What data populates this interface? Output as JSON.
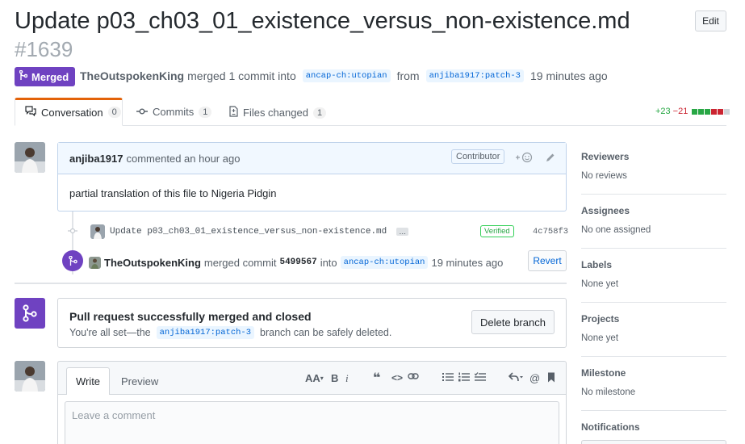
{
  "header": {
    "title": "Update p03_ch03_01_existence_versus_non-existence.md",
    "number": "#1639",
    "edit_label": "Edit"
  },
  "state": {
    "badge_label": "Merged",
    "author": "TheOutspokenKing",
    "merged_text": "merged 1 commit into",
    "base_branch": "ancap-ch:utopian",
    "from_text": "from",
    "head_branch": "anjiba1917:patch-3",
    "time": "19 minutes ago"
  },
  "tabs": [
    {
      "label": "Conversation",
      "count": "0"
    },
    {
      "label": "Commits",
      "count": "1"
    },
    {
      "label": "Files changed",
      "count": "1"
    }
  ],
  "diffstat": {
    "additions": "+23",
    "deletions": "−21",
    "colors": [
      "#28a745",
      "#28a745",
      "#28a745",
      "#cb2431",
      "#cb2431",
      "#d1d5da"
    ]
  },
  "comment": {
    "author": "anjiba1917",
    "action": "commented an hour ago",
    "role": "Contributor",
    "body": "partial translation of this file to Nigeria Pidgin"
  },
  "commit": {
    "message": "Update p03_ch03_01_existence_versus_non-existence.md",
    "ellipsis": "…",
    "verified": "Verified",
    "sha": "4c758f3"
  },
  "merge_event": {
    "author": "TheOutspokenKing",
    "text1": "merged commit",
    "commit_sha": "5499567",
    "text2": "into",
    "branch": "ancap-ch:utopian",
    "time": "19 minutes ago",
    "revert_label": "Revert"
  },
  "merged_box": {
    "title": "Pull request successfully merged and closed",
    "sub1": "You're all set—the",
    "branch": "anjiba1917:patch-3",
    "sub2": "branch can be safely deleted.",
    "delete_label": "Delete branch"
  },
  "composer": {
    "write_tab": "Write",
    "preview_tab": "Preview",
    "placeholder": "Leave a comment",
    "tools": {
      "heading": "AA",
      "bold": "B",
      "italic": "i",
      "quote": "❝",
      "code": "<>",
      "mention": "@"
    }
  },
  "sidebar": [
    {
      "title": "Reviewers",
      "value": "No reviews"
    },
    {
      "title": "Assignees",
      "value": "No one assigned"
    },
    {
      "title": "Labels",
      "value": "None yet"
    },
    {
      "title": "Projects",
      "value": "None yet"
    },
    {
      "title": "Milestone",
      "value": "No milestone"
    },
    {
      "title": "Notifications",
      "value": ""
    }
  ],
  "icons": {
    "merge": "git-merge-icon",
    "comment": "comment-discussion-icon",
    "commit": "git-commit-icon",
    "file": "file-diff-icon",
    "smiley": "smiley-icon",
    "pencil": "pencil-icon"
  },
  "accent": {
    "purple": "#6f42c1",
    "tab_top": "#e36209",
    "link": "#0366d6"
  }
}
